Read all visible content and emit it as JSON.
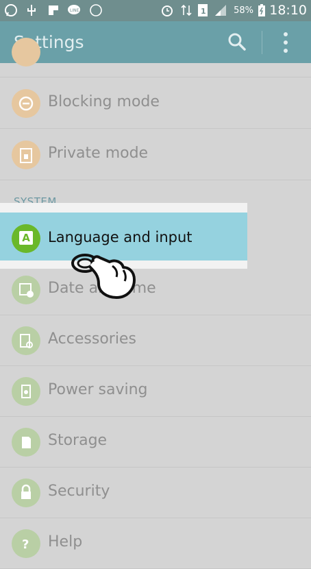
{
  "status_bar": {
    "time": "18:10",
    "battery": "58%",
    "icons": [
      "whatsapp-icon",
      "usb-icon",
      "flipboard-icon",
      "line-icon",
      "viber-icon",
      "alarm-icon",
      "data-arrows-icon",
      "sim-icon",
      "signal-icon",
      "battery-icon"
    ]
  },
  "app_bar": {
    "title": "Settings"
  },
  "list": {
    "items_top": [
      {
        "label": "Blocking mode",
        "icon": "blocking-mode-icon"
      },
      {
        "label": "Private mode",
        "icon": "private-mode-icon"
      }
    ],
    "section_label": "SYSTEM",
    "selected_item": {
      "label": "Language and input",
      "icon_letter": "A"
    },
    "items_bottom": [
      {
        "label": "Date and time",
        "icon": "calendar-clock-icon"
      },
      {
        "label": "Accessories",
        "icon": "accessories-icon"
      },
      {
        "label": "Power saving",
        "icon": "power-saving-icon"
      },
      {
        "label": "Storage",
        "icon": "storage-icon"
      },
      {
        "label": "Security",
        "icon": "lock-icon"
      },
      {
        "label": "Help",
        "icon": "help-icon"
      }
    ]
  },
  "colors": {
    "status_bar": "#6f8e8e",
    "app_bar": "#6aa0a8",
    "selected_row": "#95d2df",
    "section_label": "#6d98a2",
    "orange_icon": "#e6c79f",
    "green_icon": "#b9cfa5",
    "language_icon": "#6ab82a"
  }
}
